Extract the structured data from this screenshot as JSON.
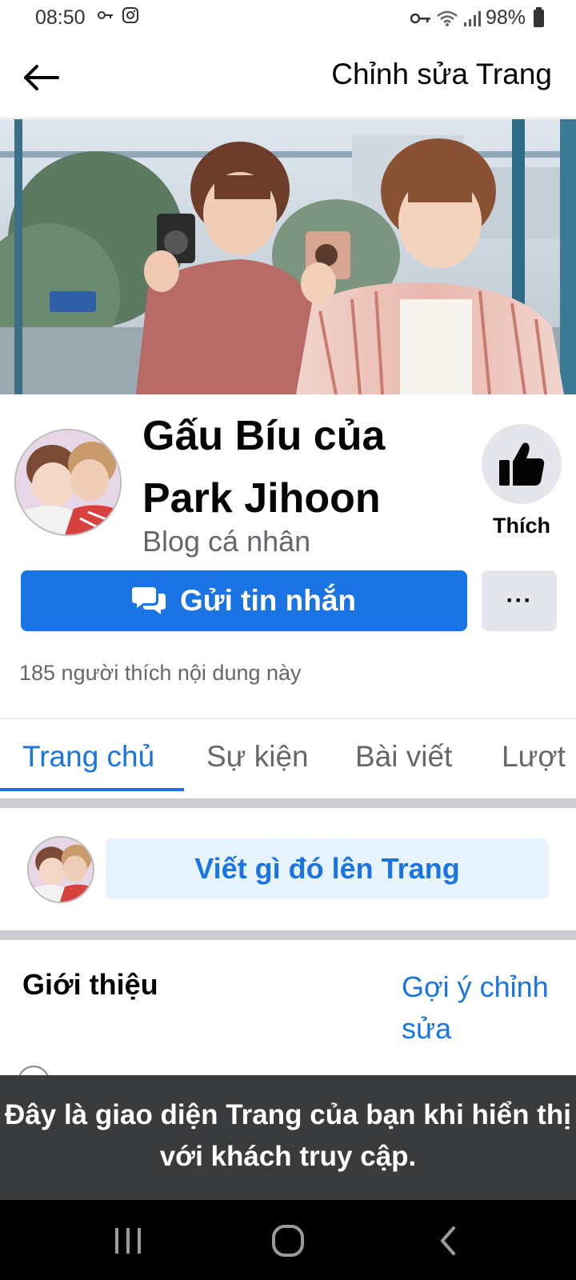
{
  "status_bar": {
    "time": "08:50",
    "battery_percent": "98%",
    "left_icons": [
      "key-icon",
      "instagram-icon"
    ],
    "right_icons": [
      "vpn-key-icon",
      "wifi-icon",
      "signal-icon",
      "battery-icon"
    ]
  },
  "header": {
    "back_icon": "arrow-left-icon",
    "edit_page_label": "Chỉnh sửa Trang"
  },
  "profile": {
    "name": "Gấu Bíu của Park Jihoon",
    "category": "Blog cá nhân",
    "like_label": "Thích",
    "like_icon": "thumbs-up-icon"
  },
  "actions": {
    "message_label": "Gửi tin nhắn",
    "message_icon": "chat-bubbles-icon",
    "more_label": "···"
  },
  "stats": {
    "likes_text": "185 người thích nội dung này"
  },
  "tabs": [
    {
      "label": "Trang chủ",
      "active": true
    },
    {
      "label": "Sự kiện",
      "active": false
    },
    {
      "label": "Bài viết",
      "active": false
    },
    {
      "label": "Lượt",
      "active": false
    }
  ],
  "composer": {
    "label": "Viết gì đó lên Trang"
  },
  "intro": {
    "title": "Giới thiệu",
    "suggest_edit_label": "Gợi ý chỉnh sửa"
  },
  "banner": {
    "text": "Đây là giao diện Trang của bạn khi hiển thị với khách truy cập."
  },
  "colors": {
    "accent": "#1b74e4",
    "banner_bg": "#3a3b3c",
    "secondary_bg": "#e4e6eb",
    "composer_bg": "#e7f3ff"
  }
}
